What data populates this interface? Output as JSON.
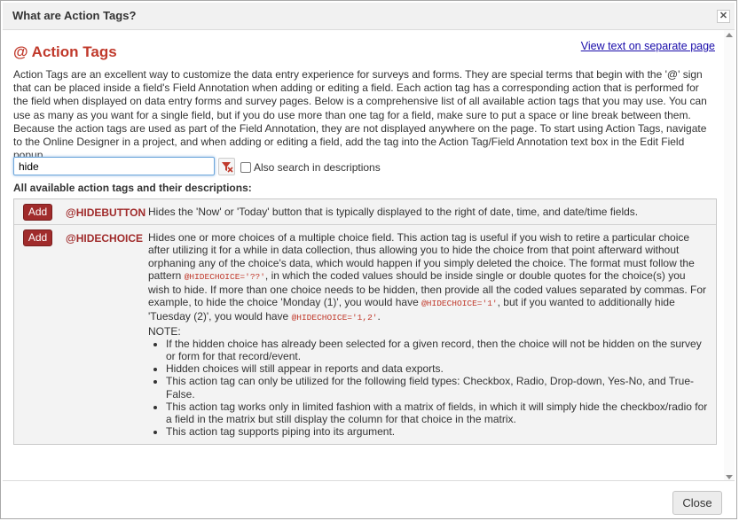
{
  "dialog": {
    "title": "What are Action Tags?",
    "close_icon": "close-icon",
    "heading": "@ Action Tags",
    "separate_link": "View text on separate page",
    "intro": "Action Tags are an excellent way to customize the data entry experience for surveys and forms. They are special terms that begin with the '@' sign that can be placed inside a field's Field Annotation when adding or editing a field. Each action tag has a corresponding action that is performed for the field when displayed on data entry forms and survey pages. Below is a comprehensive list of all available action tags that you may use. You can use as many as you want for a single field, but if you do use more than one tag for a field, make sure to put a space or line break between them. Because the action tags are used as part of the Field Annotation, they are not displayed anywhere on the page. To start using Action Tags, navigate to the Online Designer in a project, and when adding or editing a field, add the tag into the Action Tag/Field Annotation text box in the Edit Field popup.",
    "search": {
      "value": "hide",
      "also_search_label": "Also search in descriptions",
      "clear_icon": "clear-filter-icon"
    },
    "list_label": "All available action tags and their descriptions:",
    "tags": [
      {
        "add_label": "Add",
        "name": "@HIDEBUTTON",
        "description": "Hides the 'Now' or 'Today' button that is typically displayed to the right of date, time, and date/time fields."
      },
      {
        "add_label": "Add",
        "name": "@HIDECHOICE",
        "desc_parts": {
          "p1": "Hides one or more choices of a multiple choice field. This action tag is useful if you wish to retire a particular choice after utilizing it for a while in data collection, thus allowing you to hide the choice from that point afterward without orphaning any of the choice's data, which would happen if you simply deleted the choice. The format must follow the pattern ",
          "code1": "@HIDECHOICE='??'",
          "p2": ", in which the coded values should be inside single or double quotes for the choice(s) you wish to hide. If more than one choice needs to be hidden, then provide all the coded values separated by commas. For example, to hide the choice 'Monday (1)', you would have ",
          "code2": "@HIDECHOICE='1'",
          "p3": ", but if you wanted to additionally hide 'Tuesday (2)', you would have ",
          "code3": "@HIDECHOICE='1,2'",
          "p4": ".",
          "note": "NOTE:",
          "bullets": [
            "If the hidden choice has already been selected for a given record, then the choice will not be hidden on the survey or form for that record/event.",
            "Hidden choices will still appear in reports and data exports.",
            "This action tag can only be utilized for the following field types: Checkbox, Radio, Drop-down, Yes-No, and True-False.",
            "This action tag works only in limited fashion with a matrix of fields, in which it will simply hide the checkbox/radio for a field in the matrix but still display the column for that choice in the matrix.",
            "This action tag supports piping into its argument."
          ]
        }
      }
    ],
    "close_button": "Close"
  }
}
